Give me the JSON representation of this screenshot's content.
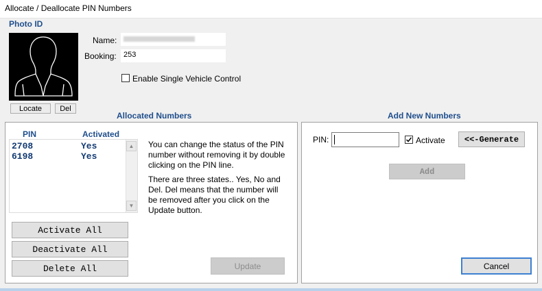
{
  "window": {
    "title": "Allocate / Deallocate PIN Numbers"
  },
  "photo": {
    "section_title": "Photo ID",
    "locate_label": "Locate",
    "del_label": "Del"
  },
  "fields": {
    "name_label": "Name:",
    "name_value": "",
    "booking_label": "Booking:",
    "booking_value": "253",
    "single_vehicle_label": "Enable Single Vehicle Control",
    "single_vehicle_checked": false
  },
  "allocated": {
    "title": "Allocated Numbers",
    "col_pin": "PIN",
    "col_activated": "Activated",
    "rows": [
      {
        "pin": "2708",
        "activated": "Yes"
      },
      {
        "pin": "6198",
        "activated": "Yes"
      }
    ],
    "info_1": "You can change the status of the PIN number without removing it by double clicking on the PIN line.",
    "info_2": "There are three states.. Yes, No and Del. Del means that the number will be removed after you click on the Update button.",
    "activate_all": "Activate All",
    "deactivate_all": "Deactivate All",
    "delete_all": "Delete All",
    "update": "Update"
  },
  "add_new": {
    "title": "Add New Numbers",
    "pin_label": "PIN:",
    "pin_value": "",
    "activate_label": "Activate",
    "activate_checked": true,
    "generate": "<<-Generate",
    "add": "Add",
    "cancel": "Cancel"
  }
}
